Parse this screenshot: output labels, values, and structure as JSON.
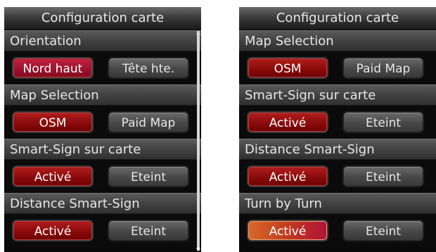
{
  "panels": [
    {
      "title": "Configuration carte",
      "sections": [
        {
          "header": "Orientation",
          "left": "Nord haut",
          "right": "Tête hte."
        },
        {
          "header": "Map Selection",
          "left": "OSM",
          "right": "Paid Map"
        },
        {
          "header": "Smart-Sign sur carte",
          "left": "Activé",
          "right": "Eteint"
        },
        {
          "header": "Distance Smart-Sign",
          "left": "Activé",
          "right": "Eteint"
        }
      ]
    },
    {
      "title": "Configuration carte",
      "sections": [
        {
          "header": "Map Selection",
          "left": "OSM",
          "right": "Paid Map"
        },
        {
          "header": "Smart-Sign sur carte",
          "left": "Activé",
          "right": "Eteint"
        },
        {
          "header": "Distance Smart-Sign",
          "left": "Activé",
          "right": "Eteint"
        },
        {
          "header": "Turn by Turn",
          "left": "Activé",
          "right": "Eteint"
        }
      ]
    }
  ],
  "colors": {
    "selected": "#8e0d0d",
    "unselected": "#4a4a4a",
    "highlight": "#d86a2b"
  }
}
